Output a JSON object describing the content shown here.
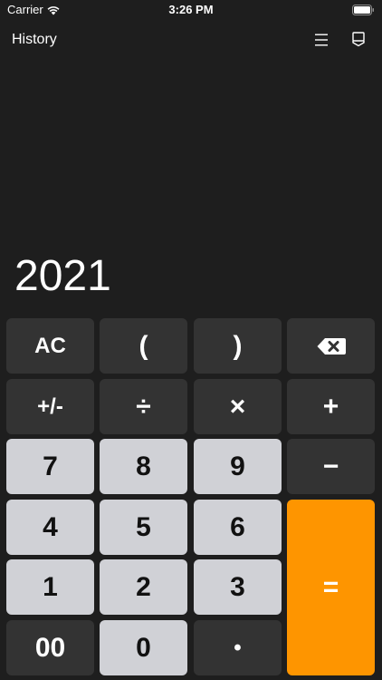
{
  "status_bar": {
    "carrier": "Carrier",
    "time": "3:26 PM",
    "wifi_icon": "wifi-icon",
    "battery_icon": "battery-icon"
  },
  "nav": {
    "history_label": "History",
    "menu_icon": "menu-icon",
    "panel_icon": "panel-icon"
  },
  "display": {
    "value": "2021"
  },
  "keys": {
    "ac": "AC",
    "open_paren": "(",
    "close_paren": ")",
    "backspace_icon": "backspace-icon",
    "plus_minus": "+/-",
    "divide": "÷",
    "multiply": "×",
    "add": "+",
    "seven": "7",
    "eight": "8",
    "nine": "9",
    "subtract": "−",
    "four": "4",
    "five": "5",
    "six": "6",
    "equals": "=",
    "one": "1",
    "two": "2",
    "three": "3",
    "double_zero": "00",
    "zero": "0",
    "decimal": "•"
  },
  "colors": {
    "background": "#1e1e1e",
    "dark_key": "#333333",
    "light_key": "#d0d1d6",
    "accent": "#fe9500"
  }
}
